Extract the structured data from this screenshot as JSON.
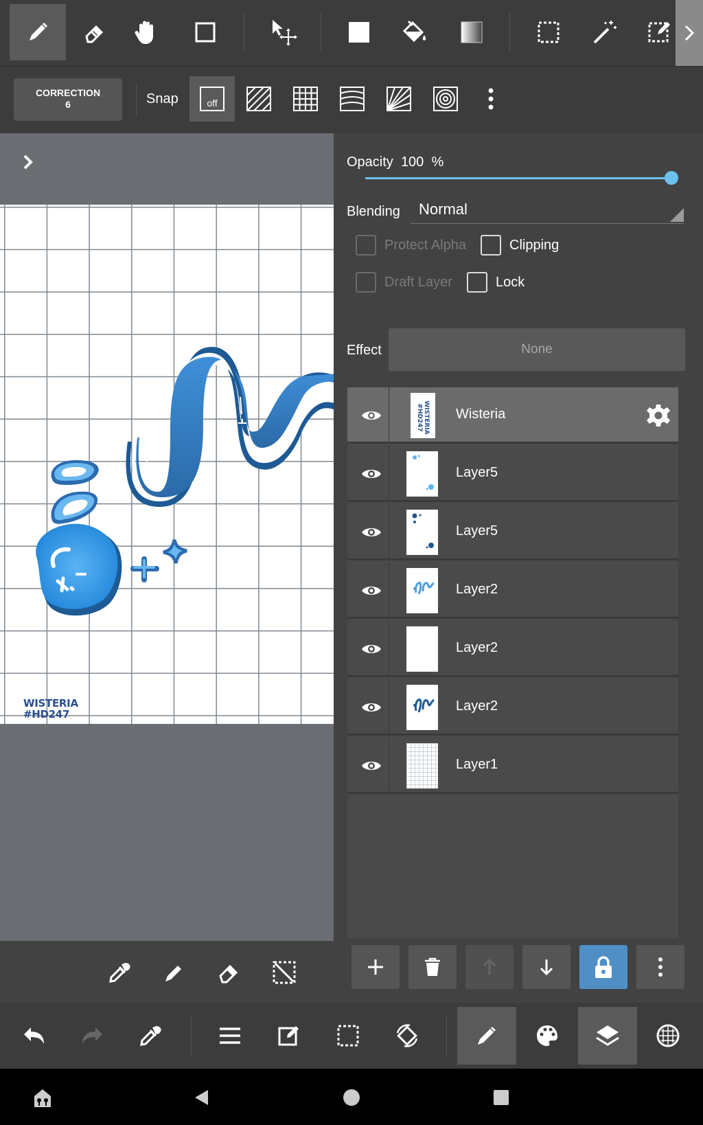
{
  "toolbar": {
    "tools": [
      {
        "name": "pen-icon",
        "active": true
      },
      {
        "name": "eraser-icon"
      },
      {
        "name": "hand-icon"
      },
      {
        "name": "shape-icon"
      },
      {
        "name": "move-icon"
      },
      {
        "name": "fill-icon"
      },
      {
        "name": "bucket-icon"
      },
      {
        "name": "gradient-icon"
      },
      {
        "name": "select-rect-icon"
      },
      {
        "name": "magic-wand-icon"
      },
      {
        "name": "select-pen-icon"
      }
    ]
  },
  "options": {
    "correction_title": "CORRECTION",
    "correction_value": "6",
    "snap_label": "Snap",
    "snap_off_label": "off"
  },
  "canvas": {
    "signature_line1": "WISTERIA",
    "signature_line2": "#HD247"
  },
  "layer_props": {
    "opacity_label": "Opacity",
    "opacity_value": "100",
    "opacity_unit": "%",
    "opacity_fraction": 1.0,
    "blending_label": "Blending",
    "blending_value": "Normal",
    "protect_alpha_label": "Protect Alpha",
    "clipping_label": "Clipping",
    "draft_layer_label": "Draft Layer",
    "lock_label": "Lock",
    "effect_label": "Effect",
    "effect_value": "None"
  },
  "layers": [
    {
      "name": "Wisteria",
      "selected": true,
      "visible": true
    },
    {
      "name": "Layer5",
      "visible": true
    },
    {
      "name": "Layer5",
      "visible": true
    },
    {
      "name": "Layer2",
      "visible": true
    },
    {
      "name": "Layer2",
      "visible": true
    },
    {
      "name": "Layer2",
      "visible": true
    },
    {
      "name": "Layer1",
      "visible": true
    }
  ],
  "thumbnail_text": "WISTERIA #HD247",
  "colors": {
    "accent": "#6cc0f0",
    "lock_active": "#4f8fc6",
    "ribbon_dark": "#1e5a94",
    "ribbon_light": "#4f9de0"
  }
}
